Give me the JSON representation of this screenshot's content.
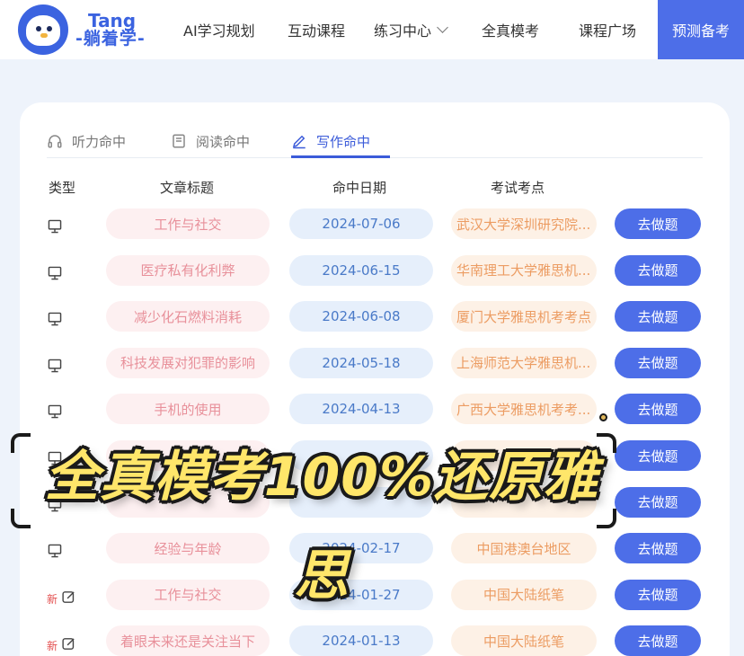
{
  "brand": {
    "line1": "Tang",
    "line2": "-躺着学-"
  },
  "nav": {
    "items": [
      "AI学习规划",
      "互动课程",
      "练习中心",
      "全真模考",
      "课程广场"
    ],
    "cta": "预测备考"
  },
  "tabs": [
    {
      "label": "听力命中",
      "icon": "headphones-icon"
    },
    {
      "label": "阅读命中",
      "icon": "book-icon"
    },
    {
      "label": "写作命中",
      "icon": "pen-icon"
    }
  ],
  "table": {
    "headers": [
      "类型",
      "文章标题",
      "命中日期",
      "考试考点"
    ],
    "action_label": "去做题",
    "rows": [
      {
        "type": "computer",
        "title": "工作与社交",
        "date": "2024-07-06",
        "point": "武汉大学深圳研究院..."
      },
      {
        "type": "computer",
        "title": "医疗私有化利弊",
        "date": "2024-06-15",
        "point": "华南理工大学雅思机..."
      },
      {
        "type": "computer",
        "title": "减少化石燃料消耗",
        "date": "2024-06-08",
        "point": "厦门大学雅思机考考点"
      },
      {
        "type": "computer",
        "title": "科技发展对犯罪的影响",
        "date": "2024-05-18",
        "point": "上海师范大学雅思机..."
      },
      {
        "type": "computer",
        "title": "手机的使用",
        "date": "2024-04-13",
        "point": "广西大学雅思机考考..."
      },
      {
        "type": "computer",
        "title": "",
        "date": "",
        "point": ""
      },
      {
        "type": "computer",
        "title": "",
        "date": "",
        "point": ""
      },
      {
        "type": "computer",
        "title": "经验与年龄",
        "date": "2024-02-17",
        "point": "中国港澳台地区"
      },
      {
        "type": "paper",
        "badge": "新",
        "title": "工作与社交",
        "date": "2024-01-27",
        "point": "中国大陆纸笔"
      },
      {
        "type": "paper",
        "badge": "新",
        "title": "着眼未来还是关注当下",
        "date": "2024-01-13",
        "point": "中国大陆纸笔"
      }
    ]
  },
  "overlay": {
    "text": "全真模考100%还原雅思"
  },
  "colors": {
    "accent": "#4d6ee8",
    "title_pill": "#fdf0f1",
    "date_pill": "#e6effb",
    "point_pill": "#fdf1e6",
    "overlay_text": "#ffe66a"
  }
}
